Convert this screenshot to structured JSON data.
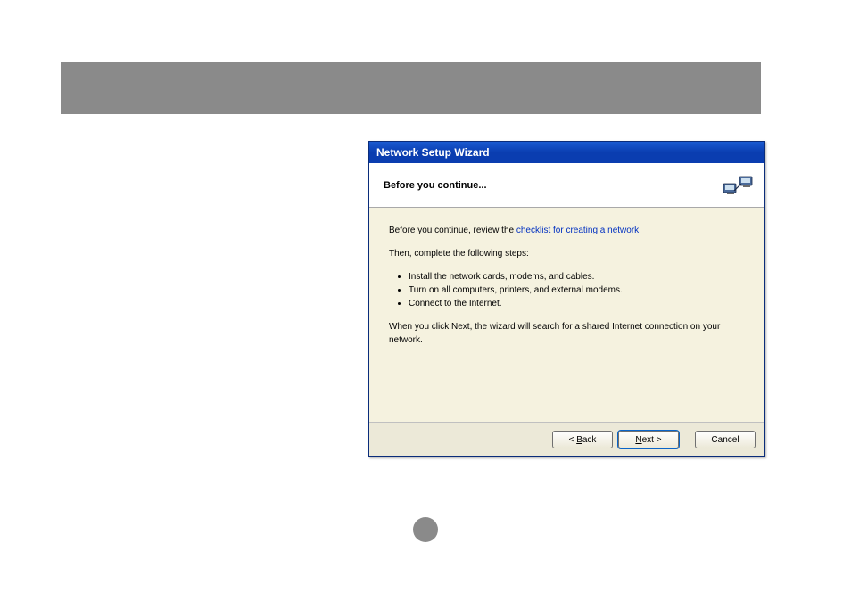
{
  "titlebar": {
    "title": "Network Setup Wizard"
  },
  "header": {
    "title": "Before you continue..."
  },
  "body": {
    "intro_prefix": "Before you continue, review the ",
    "intro_link": "checklist for creating a network",
    "intro_suffix": ".",
    "then_line": "Then, complete the following steps:",
    "steps": [
      "Install the network cards, modems, and cables.",
      "Turn on all computers, printers, and external modems.",
      "Connect to the Internet."
    ],
    "footer": "When you click Next, the wizard will search for a shared Internet connection on your network."
  },
  "buttons": {
    "back_prefix": "< ",
    "back_u": "B",
    "back_suffix": "ack",
    "next_u": "N",
    "next_suffix": "ext >",
    "cancel": "Cancel"
  }
}
